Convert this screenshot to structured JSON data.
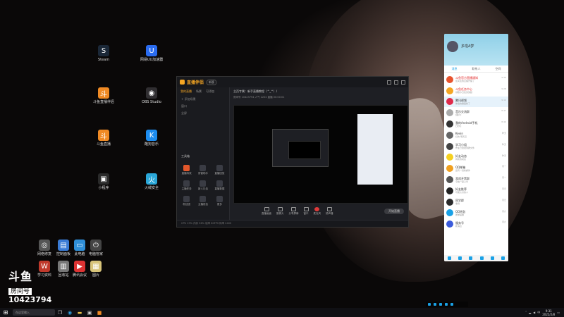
{
  "desktop": {
    "icons": [
      {
        "label": "Steam",
        "glyph": "S",
        "color": "#1b2838"
      },
      {
        "label": "网易UU加速器",
        "glyph": "U",
        "color": "#2a6cf0"
      },
      {
        "label": "斗鱼直播伴侣",
        "glyph": "斗",
        "color": "#f08a24"
      },
      {
        "label": "OBS Studio",
        "glyph": "◉",
        "color": "#302e31"
      },
      {
        "label": "斗鱼直播",
        "glyph": "斗",
        "color": "#f08a24"
      },
      {
        "label": "酷狗音乐",
        "glyph": "K",
        "color": "#1c8cf0"
      },
      {
        "label": "小程序",
        "glyph": "▣",
        "color": "#2a2a2a"
      },
      {
        "label": "火绒安全",
        "glyph": "火",
        "color": "#2aa7d8"
      },
      {
        "label": "网络修复",
        "glyph": "◎",
        "color": "#555"
      },
      {
        "label": "控制面板",
        "glyph": "▤",
        "color": "#3a7bd5"
      },
      {
        "label": "此电脑",
        "glyph": "▭",
        "color": "#2f8fd8"
      },
      {
        "label": "电脑管家",
        "glyph": "⏻",
        "color": "#444"
      },
      {
        "label": "学习资料",
        "glyph": "W",
        "color": "#c0392b"
      },
      {
        "label": "回收站",
        "glyph": "▥",
        "color": "#777"
      },
      {
        "label": "腾讯会议",
        "glyph": "▶",
        "color": "#d33"
      },
      {
        "label": "图片",
        "glyph": "▦",
        "color": "#d8c47a"
      }
    ],
    "watermark": {
      "brand": "斗鱼",
      "label": "房间号",
      "room": "10423794"
    }
  },
  "app": {
    "brand": "直播伴侣",
    "version": "新版",
    "tabs": [
      "我的直播",
      "场景",
      "可添加"
    ],
    "scenes": [
      "+ 添加场景",
      "窗口",
      "全屏"
    ],
    "tools_title": "工具箱",
    "tools": [
      "直播特效",
      "房管助手",
      "直播回放",
      "主播任务",
      "新人礼包",
      "直播数据",
      "粉丝团",
      "主播钱包",
      "更多"
    ],
    "room_title": "主页专属：新手直播教程（^_^）/",
    "room_sub": "房间号 10423794    人气 2202    直播 00:00:01",
    "bottom": [
      "直播画面",
      "摄像头",
      "分享屏幕",
      "窗口",
      "麦克风",
      "扬声器"
    ],
    "start": "开始直播",
    "status": "CPU 19%    内存 56%    帧率 60FPS    码率 2400"
  },
  "chat": {
    "user": "多啦A梦",
    "tabs": [
      "消息",
      "联系人",
      "空间"
    ],
    "rows": [
      {
        "name": "斗鱼官方直播通知",
        "sub": "您关注的主播开播了",
        "time": "9:30",
        "color": "#e8542f",
        "red": true
      },
      {
        "name": "斗鱼任务中心",
        "sub": "领取今日任务奖励",
        "time": "9:28",
        "color": "#f5a623",
        "red": true
      },
      {
        "name": "腾讯视频",
        "sub": "你追的剧更新了",
        "time": "9:12",
        "color": "#e02a4a",
        "red": false
      },
      {
        "name": "音乐交流群",
        "sub": "[图片]",
        "time": "8:47",
        "color": "#aaaaaa",
        "red": false
      },
      {
        "name": "我的Android手机",
        "sub": "[文件]",
        "time": "8:40",
        "color": "#333333",
        "red": false
      },
      {
        "name": "Kevin",
        "sub": "好的 明天见",
        "time": "昨天",
        "color": "#666666",
        "red": false
      },
      {
        "name": "学习小组",
        "sub": "作业已经发到群文件",
        "time": "昨天",
        "color": "#444444",
        "red": false
      },
      {
        "name": "好友动态",
        "sub": "有新的动态",
        "time": "昨天",
        "color": "#f5d020",
        "red": false
      },
      {
        "name": "QQ邮箱",
        "sub": "您有一封新邮件",
        "time": "周一",
        "color": "#f0a020",
        "red": false
      },
      {
        "name": "游戏开黑群",
        "sub": "今晚一起上分",
        "time": "周一",
        "color": "#555555",
        "red": false
      },
      {
        "name": "好友推荐",
        "sub": "可能认识的人",
        "time": "周日",
        "color": "#222222",
        "red": false
      },
      {
        "name": "同学群",
        "sub": "收到",
        "time": "周日",
        "color": "#2a2a2a",
        "red": false
      },
      {
        "name": "QQ钱包",
        "sub": "账单提醒",
        "time": "周六",
        "color": "#1aa1e6",
        "red": false
      },
      {
        "name": "服务号",
        "sub": "新消息",
        "time": "周六",
        "color": "#3b5bdb",
        "red": false
      }
    ]
  },
  "taskbar": {
    "search_placeholder": "在这里输入",
    "icons": [
      "search-icon",
      "task-view-icon",
      "edge-icon",
      "explorer-icon",
      "store-icon",
      "douyu-icon"
    ],
    "time": "9:31",
    "date": "2022/2/8",
    "ime": "中"
  }
}
